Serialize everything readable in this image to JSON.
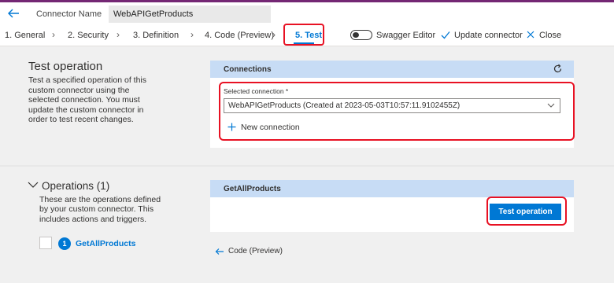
{
  "header": {
    "connector_name_label": "Connector Name",
    "connector_name_value": "WebAPIGetProducts"
  },
  "nav": {
    "steps": [
      "1. General",
      "2. Security",
      "3. Definition",
      "4. Code (Preview)",
      "5. Test"
    ],
    "active_step_index": 4,
    "swagger_editor_label": "Swagger Editor",
    "swagger_editor_on": false,
    "update_connector_label": "Update connector",
    "close_label": "Close"
  },
  "test_operation": {
    "title": "Test operation",
    "description": "Test a specified operation of this custom connector using the selected connection. You must update the custom connector in order to test recent changes."
  },
  "connections": {
    "header": "Connections",
    "selected_label": "Selected connection *",
    "selected_value": "WebAPIGetProducts (Created at 2023-05-03T10:57:11.9102455Z)",
    "new_connection_label": "New connection"
  },
  "operations": {
    "title": "Operations (1)",
    "description": "These are the operations defined by your custom connector. This includes actions and triggers.",
    "items": [
      {
        "number": "1",
        "name": "GetAllProducts"
      }
    ]
  },
  "operation_panel": {
    "header": "GetAllProducts",
    "test_button_label": "Test operation"
  },
  "footer": {
    "back_label": "Code (Preview)"
  },
  "colors": {
    "accent": "#0078d4",
    "highlight": "#e81123",
    "panel_header": "#c7dcf5",
    "topbar": "#742774"
  }
}
